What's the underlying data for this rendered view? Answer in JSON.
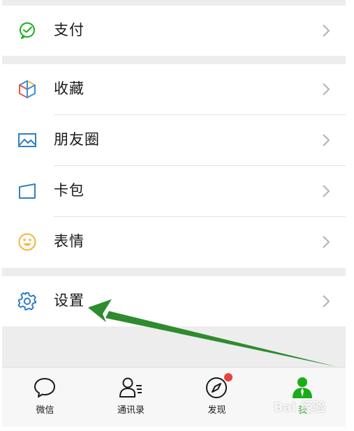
{
  "menu": {
    "pay": {
      "label": "支付",
      "icon": "wechat-pay-icon"
    },
    "favorites": {
      "label": "收藏",
      "icon": "cube-icon"
    },
    "moments": {
      "label": "朋友圈",
      "icon": "image-icon"
    },
    "cards": {
      "label": "卡包",
      "icon": "card-icon"
    },
    "stickers": {
      "label": "表情",
      "icon": "smile-icon"
    },
    "settings": {
      "label": "设置",
      "icon": "gear-icon"
    }
  },
  "tabbar": {
    "chats": {
      "label": "微信",
      "icon": "chat-bubble-icon"
    },
    "contacts": {
      "label": "通讯录",
      "icon": "contacts-icon"
    },
    "discover": {
      "label": "发现",
      "icon": "compass-icon"
    },
    "me": {
      "label": "我",
      "icon": "person-icon"
    }
  },
  "watermark": {
    "text": "Bai 经验"
  },
  "colors": {
    "brand_green": "#1aad19",
    "badge_red": "#e64340",
    "arrow_green": "#2e8b2e"
  }
}
